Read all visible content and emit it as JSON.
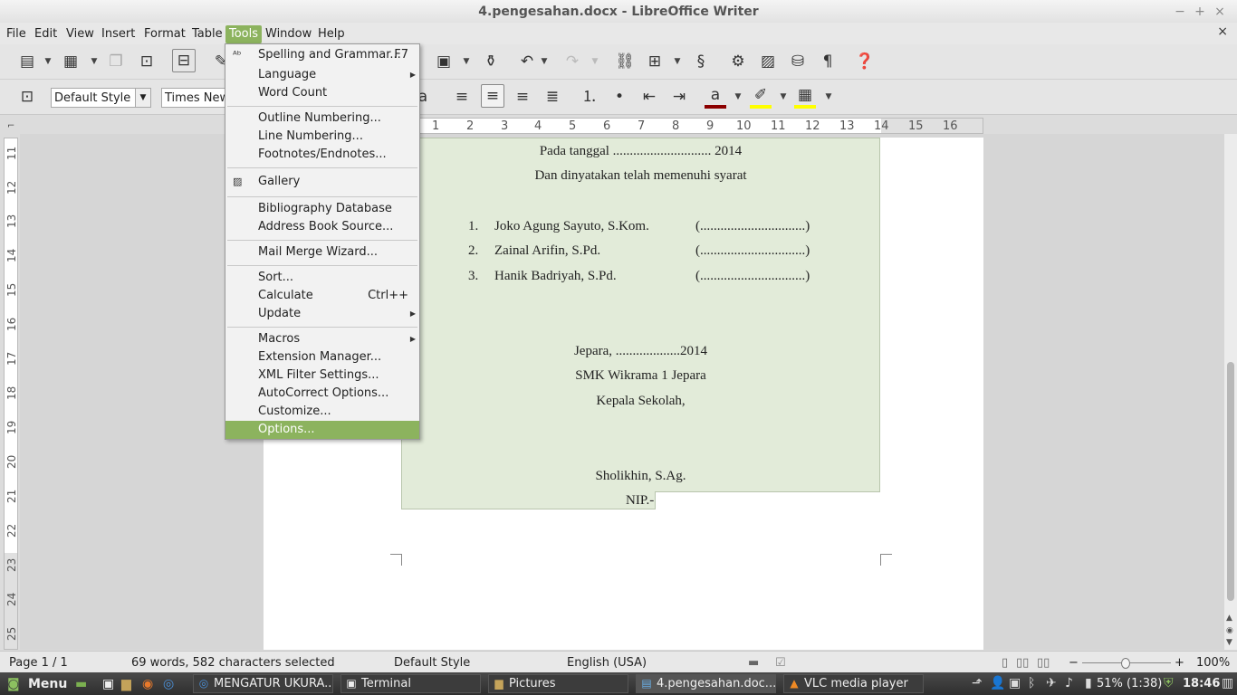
{
  "window": {
    "title": "4.pengesahan.docx - LibreOffice Writer",
    "minimize": "−",
    "maximize": "+",
    "close": "×",
    "doc_close": "×"
  },
  "menubar": {
    "items": [
      "File",
      "Edit",
      "View",
      "Insert",
      "Format",
      "Table",
      "Tools",
      "Window",
      "Help"
    ],
    "active": "Tools"
  },
  "toolbar2": {
    "paragraph_style": "Default Style",
    "font_name": "Times New"
  },
  "ruler_h": [
    "1",
    "2",
    "3",
    "4",
    "5",
    "6",
    "7",
    "8",
    "9",
    "10",
    "11",
    "12",
    "13",
    "14",
    "15",
    "16"
  ],
  "ruler_v": [
    "11",
    "12",
    "13",
    "14",
    "15",
    "16",
    "17",
    "18",
    "19",
    "20",
    "21",
    "22",
    "23",
    "24",
    "25"
  ],
  "tools_menu": {
    "items": [
      {
        "label": "Spelling and Grammar...",
        "shortcut": "F7",
        "icon": "spellcheck-icon"
      },
      {
        "label": "Language",
        "submenu": true
      },
      {
        "label": "Word Count"
      },
      {
        "label": "Outline Numbering..."
      },
      {
        "label": "Line Numbering..."
      },
      {
        "label": "Footnotes/Endnotes..."
      },
      {
        "label": "Gallery",
        "icon": "gallery-icon"
      },
      {
        "label": "Bibliography Database"
      },
      {
        "label": "Address Book Source..."
      },
      {
        "label": "Mail Merge Wizard..."
      },
      {
        "label": "Sort..."
      },
      {
        "label": "Calculate",
        "shortcut": "Ctrl++"
      },
      {
        "label": "Update",
        "submenu": true
      },
      {
        "label": "Macros",
        "submenu": true
      },
      {
        "label": "Extension Manager..."
      },
      {
        "label": "XML Filter Settings..."
      },
      {
        "label": "AutoCorrect Options..."
      },
      {
        "label": "Customize..."
      },
      {
        "label": "Options...",
        "highlighted": true
      }
    ]
  },
  "document": {
    "line1": "Pada tanggal ............................. 2014",
    "line2": "Dan dinyatakan telah memenuhi syarat",
    "members": [
      {
        "num": "1.",
        "name": "Joko Agung Sayuto, S.Kom.",
        "sign": "(...............................)"
      },
      {
        "num": "2.",
        "name": "Zainal Arifin, S.Pd.",
        "sign": "(...............................)"
      },
      {
        "num": "3.",
        "name": "Hanik Badriyah, S.Pd.",
        "sign": "(...............................)"
      }
    ],
    "place_date": "Jepara, ...................2014",
    "school": "SMK Wikrama 1 Jepara",
    "position": "Kepala Sekolah,",
    "signer": "Sholikhin, S.Ag.",
    "nip": "NIP.-"
  },
  "status": {
    "page": "Page 1 / 1",
    "words": "69 words, 582 characters selected",
    "style": "Default Style",
    "language": "English (USA)",
    "zoom": "100%"
  },
  "taskbar": {
    "menu": "Menu",
    "windows": [
      {
        "label": "MENGATUR UKURA...",
        "active": false
      },
      {
        "label": "Terminal",
        "active": false
      },
      {
        "label": "Pictures",
        "active": false
      },
      {
        "label": "4.pengesahan.doc...",
        "active": true
      },
      {
        "label": "VLC media player",
        "active": false
      }
    ],
    "battery": "51% (1:38)",
    "clock": "18:46"
  },
  "colors": {
    "menu_highlight": "#8cb35e",
    "frame_bg": "#e2ebd9",
    "font_color_bar": "#8b0000",
    "highlight_bar": "#ffff00"
  }
}
